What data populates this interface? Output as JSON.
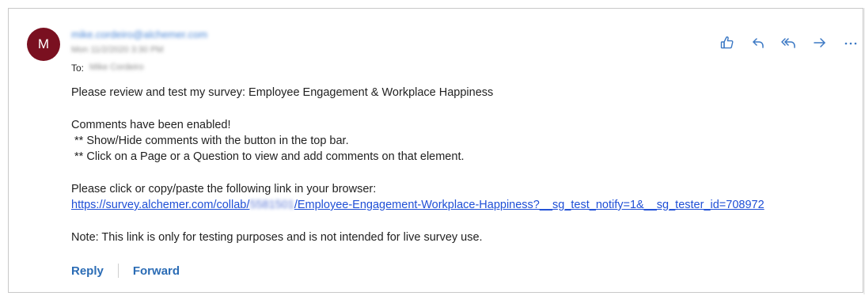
{
  "sender": {
    "avatar_initial": "M",
    "avatar_color": "#7a1020",
    "email": "mike.cordeiro@alchemer.com",
    "date": "Mon 11/2/2020 3:30 PM"
  },
  "recipient": {
    "label": "To:",
    "name": "Mike Cordeiro"
  },
  "actions": [
    {
      "icon": "thumbs-up-icon"
    },
    {
      "icon": "reply-icon"
    },
    {
      "icon": "reply-all-icon"
    },
    {
      "icon": "forward-icon"
    },
    {
      "icon": "more-icon"
    }
  ],
  "body": {
    "line1": "Please review and test my survey: Employee Engagement & Workplace Happiness",
    "line2": "Comments have been enabled!",
    "line3": " ** Show/Hide comments with the button in the top bar.",
    "line4": " ** Click on a Page or a Question to view and add comments on that element.",
    "line5": "Please click or copy/paste the following link in your browser:",
    "link_prefix": "https://survey.alchemer.com/collab/",
    "link_hidden": "5581501",
    "link_suffix": "/Employee-Engagement-Workplace-Happiness?__sg_test_notify=1&__sg_tester_id=708972",
    "note": "Note: This link is only for testing purposes and is not intended for live survey use."
  },
  "footer": {
    "reply": "Reply",
    "forward": "Forward"
  },
  "colors": {
    "accent": "#2b6cb5",
    "icon": "#3b78c4",
    "link": "#1f4fd6"
  }
}
